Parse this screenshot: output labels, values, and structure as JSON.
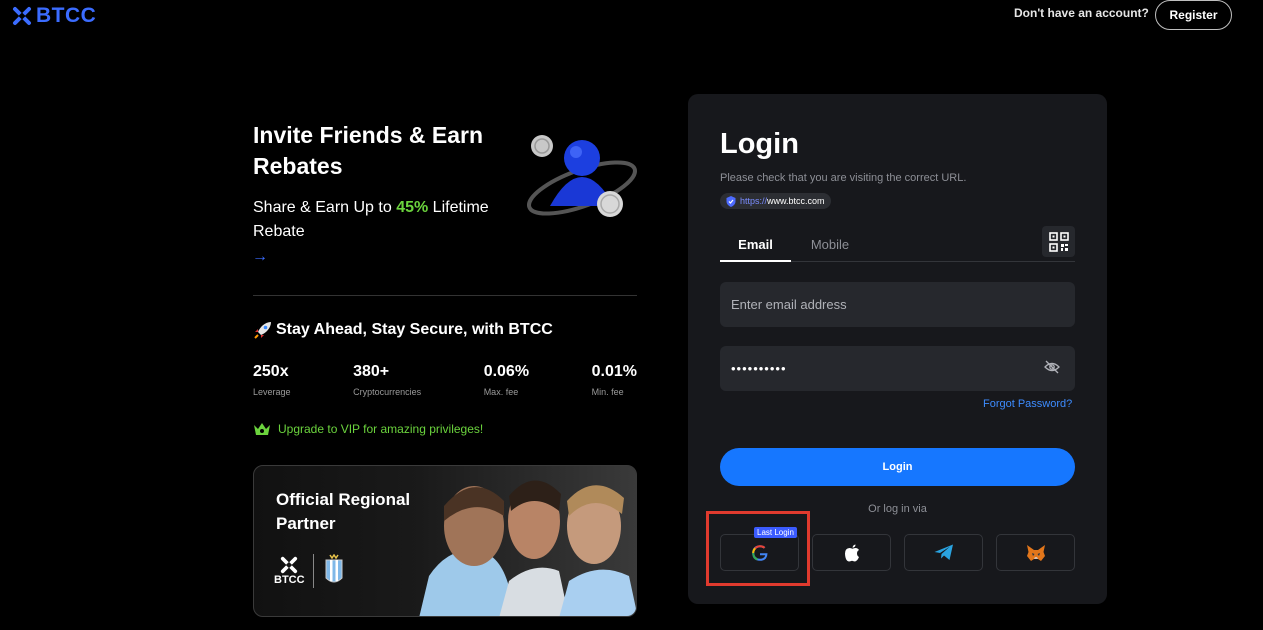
{
  "header": {
    "brand": "BTCC",
    "no_account_text": "Don't have an account?",
    "register_label": "Register"
  },
  "promo": {
    "title": "Invite Friends & Earn Rebates",
    "subtitle_before": "Share & Earn Up to ",
    "subtitle_highlight": "45%",
    "subtitle_after": " Lifetime Rebate",
    "arrow": "→"
  },
  "secure": {
    "title": "Stay Ahead, Stay Secure, with BTCC",
    "stats": [
      {
        "value": "250x",
        "label": "Leverage"
      },
      {
        "value": "380+",
        "label": "Cryptocurrencies"
      },
      {
        "value": "0.06%",
        "label": "Max. fee"
      },
      {
        "value": "0.01%",
        "label": "Min. fee"
      }
    ],
    "vip_text": "Upgrade to VIP for amazing privileges!"
  },
  "partner": {
    "title": "Official Regional Partner",
    "brand": "BTCC"
  },
  "login": {
    "title": "Login",
    "note": "Please check that you are visiting the correct URL.",
    "url_proto": "https://",
    "url_host": "www.btcc.com",
    "tabs": [
      {
        "label": "Email"
      },
      {
        "label": "Mobile"
      }
    ],
    "email_placeholder": "Enter email address",
    "password_value": "••••••••••",
    "forgot_label": "Forgot Password?",
    "submit_label": "Login",
    "or_via": "Or log in via",
    "last_login_badge": "Last Login",
    "social": [
      "google-icon",
      "apple-icon",
      "telegram-icon",
      "metamask-icon"
    ]
  },
  "colors": {
    "accent": "#1677ff",
    "brand_blue": "#3b6cff",
    "green": "#6bd33d",
    "highlight_red": "#e03a2e",
    "card_bg": "#17181c",
    "field_bg": "#26282d"
  }
}
